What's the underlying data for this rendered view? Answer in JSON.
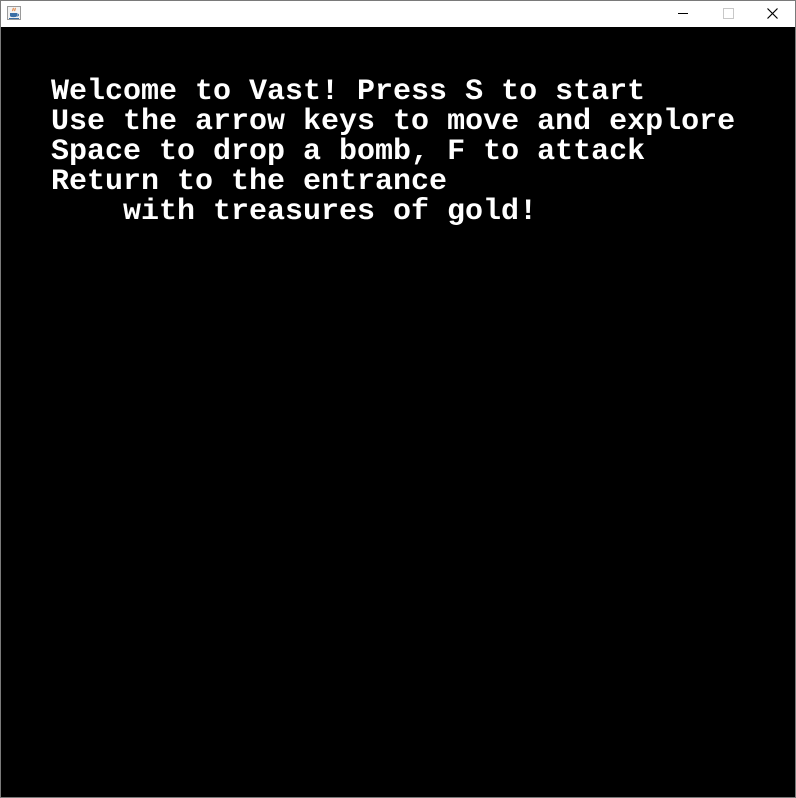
{
  "window": {
    "title": "",
    "icon": "java-cup-icon",
    "controls": [
      "minimize-icon",
      "maximize-icon",
      "close-icon"
    ]
  },
  "colors": {
    "background": "#000000",
    "text": "#ffffff"
  },
  "instructions": {
    "line1": "Welcome to Vast! Press S to start",
    "line2": "Use the arrow keys to move and explore",
    "line3": "Space to drop a bomb, F to attack",
    "line4": "Return to the entrance",
    "line5": "with treasures of gold!"
  }
}
